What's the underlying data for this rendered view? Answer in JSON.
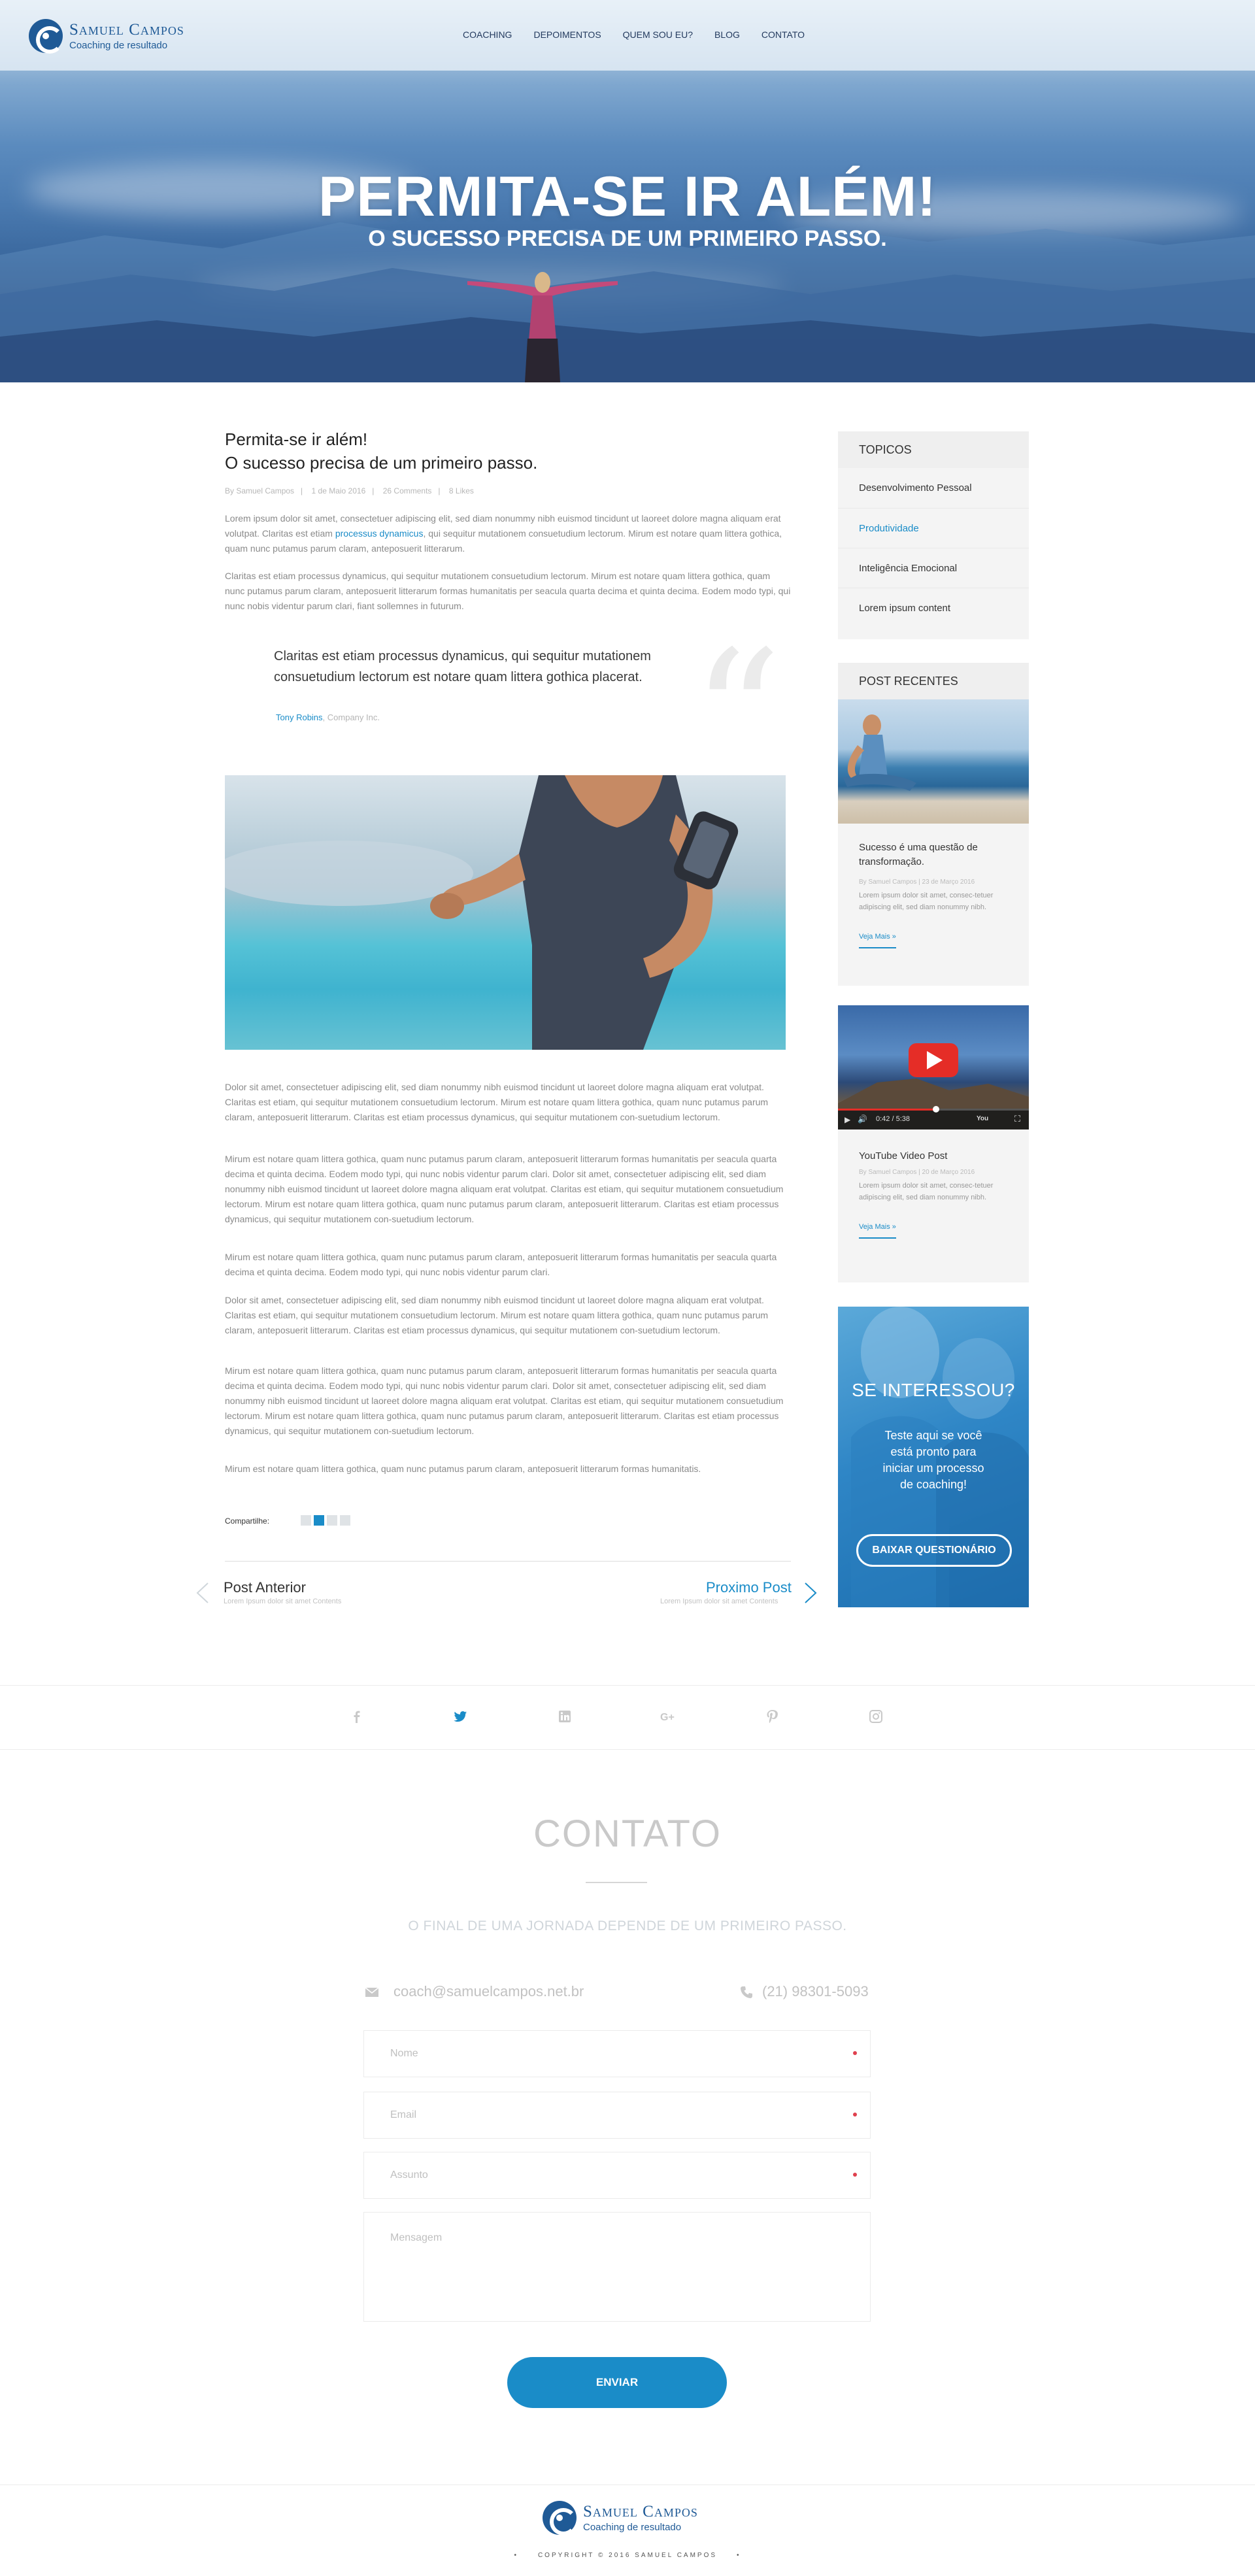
{
  "brand": {
    "name": "Samuel Campos",
    "tagline": "Coaching de resultado",
    "primary_color": "#1a8cc8",
    "logo_color": "#1f5a96"
  },
  "nav": {
    "items": [
      "COACHING",
      "DEPOIMENTOS",
      "QUEM SOU EU?",
      "BLOG",
      "CONTATO"
    ]
  },
  "hero": {
    "title": "PERMITA-SE IR ALÉM!",
    "subtitle": "O SUCESSO PRECISA DE UM PRIMEIRO PASSO."
  },
  "post": {
    "title_line1": "Permita-se ir além!",
    "title_line2": "O sucesso precisa de um primeiro passo.",
    "author": "By Samuel Campos",
    "date": "1 de Maio 2016",
    "comments": "26 Comments",
    "likes": "8 Likes",
    "intro_before_link": "Lorem ipsum dolor sit amet, consectetuer adipiscing elit, sed diam nonummy nibh euismod tincidunt ut laoreet dolore magna aliquam erat volutpat. Claritas est etiam ",
    "intro_link": "processus dynamicus",
    "intro_after_link": ", qui sequitur mutationem consuetudium lectorum. Mirum est notare quam littera gothica, quam nunc putamus parum claram, anteposuerit litterarum.",
    "para2": "Claritas est etiam processus dynamicus, qui sequitur mutationem consuetudium lectorum. Mirum est notare quam littera gothica, quam nunc putamus parum claram, anteposuerit litterarum formas humanitatis per seacula quarta decima et quinta decima. Eodem modo typi, qui nunc nobis videntur parum clari, fiant sollemnes in futurum.",
    "quote": "Claritas est etiam processus dynamicus, qui sequitur mutationem consuetudium lectorum est notare quam littera gothica placerat.",
    "quote_author": "Tony Robins",
    "quote_company": ", Company Inc.",
    "body": [
      "Dolor sit amet, consectetuer adipiscing elit, sed diam nonummy nibh euismod tincidunt ut laoreet dolore magna aliquam erat volutpat. Claritas est etiam, qui sequitur mutationem consuetudium lectorum. Mirum est notare quam littera gothica, quam nunc putamus parum claram, anteposuerit litterarum. Claritas est etiam processus dynamicus, qui sequitur mutationem con-suetudium lectorum.",
      "Mirum est notare quam littera gothica, quam nunc putamus parum claram, anteposuerit litterarum formas humanitatis per seacula quarta decima et quinta decima. Eodem modo typi, qui nunc nobis videntur parum clari. Dolor sit amet, consectetuer adipiscing elit, sed diam nonummy nibh euismod tincidunt ut laoreet dolore magna aliquam erat volutpat. Claritas est etiam, qui sequitur mutationem consuetudium lectorum. Mirum est notare quam littera gothica, quam nunc putamus parum claram, anteposuerit litterarum. Claritas est etiam processus dynamicus, qui sequitur mutationem con-suetudium lectorum.",
      "Mirum est notare quam littera gothica, quam nunc putamus parum claram, anteposuerit litterarum formas humanitatis per seacula quarta decima et quinta decima. Eodem modo typi, qui nunc nobis videntur parum clari.",
      "Dolor sit amet, consectetuer adipiscing elit, sed diam nonummy nibh euismod tincidunt ut laoreet dolore magna aliquam erat volutpat. Claritas est etiam, qui sequitur mutationem consuetudium lectorum. Mirum est notare quam littera gothica, quam nunc putamus parum claram, anteposuerit litterarum. Claritas est etiam processus dynamicus, qui sequitur mutationem con-suetudium lectorum.",
      "Mirum est notare quam littera gothica, quam nunc putamus parum claram, anteposuerit litterarum formas humanitatis per seacula quarta decima et quinta decima. Eodem modo typi, qui nunc nobis videntur parum clari. Dolor sit amet, consectetuer adipiscing elit, sed diam nonummy nibh euismod tincidunt ut laoreet dolore magna aliquam erat volutpat. Claritas est etiam, qui sequitur mutationem consuetudium lectorum. Mirum est notare quam littera gothica, quam nunc putamus parum claram, anteposuerit litterarum. Claritas est etiam processus dynamicus, qui sequitur mutationem con-suetudium lectorum.",
      "Mirum est notare quam littera gothica, quam nunc putamus parum claram, anteposuerit litterarum formas humanitatis."
    ],
    "share_label": "Compartilhe:",
    "prev_label": "Post Anterior",
    "prev_sub": "Lorem Ipsum dolor sit amet Contents",
    "next_label": "Proximo Post",
    "next_sub": "Lorem Ipsum dolor sit amet Contents"
  },
  "sidebar": {
    "topics_title": "TOPICOS",
    "topics": [
      "Desenvolvimento Pessoal",
      "Produtividade",
      "Inteligência Emocional",
      "Lorem ipsum content"
    ],
    "recent_title": "POST RECENTES",
    "recent": [
      {
        "title": "Sucesso é uma questão de transformação.",
        "meta": "By Samuel Campos   |   23 de Março 2016",
        "body": "Lorem ipsum dolor sit amet, consec-tetuer adipiscing elit, sed diam nonummy nibh.",
        "more": "Veja Mais »"
      },
      {
        "title": "YouTube Video Post",
        "meta": "By Samuel Campos   |   20 de Março 2016",
        "body": "Lorem ipsum dolor sit amet, consec-tetuer adipiscing elit, sed diam nonummy nibh.",
        "more": "Veja Mais »",
        "video_time": "0:42 / 5:38"
      }
    ],
    "cta_title": "SE INTERESSOU?",
    "cta_text": "Teste aqui se você está pronto para iniciar um processo de coaching!",
    "cta_button": "BAIXAR QUESTIONÁRIO"
  },
  "social": [
    "facebook-icon",
    "twitter-icon",
    "linkedin-icon",
    "google-plus-icon",
    "pinterest-icon",
    "instagram-icon"
  ],
  "contact": {
    "title": "CONTATO",
    "subtitle": "O FINAL DE UMA JORNADA DEPENDE DE UM PRIMEIRO PASSO.",
    "email": "coach@samuelcampos.net.br",
    "phone": "(21) 98301-5093",
    "name_placeholder": "Nome",
    "email_placeholder": "Email",
    "subject_placeholder": "Assunto",
    "message_placeholder": "Mensagem",
    "send_label": "ENVIAR"
  },
  "footer": {
    "copyright": "COPYRIGHT © 2016 SAMUEL CAMPOS"
  }
}
